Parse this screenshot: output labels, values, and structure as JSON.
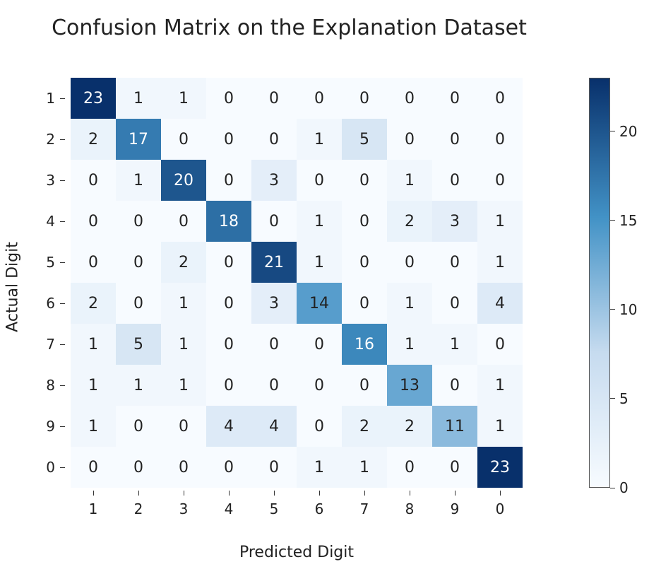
{
  "chart_data": {
    "type": "heatmap",
    "title": "Confusion Matrix on the Explanation Dataset",
    "xlabel": "Predicted Digit",
    "ylabel": "Actual Digit",
    "x_categories": [
      "1",
      "2",
      "3",
      "4",
      "5",
      "6",
      "7",
      "8",
      "9",
      "0"
    ],
    "y_categories": [
      "1",
      "2",
      "3",
      "4",
      "5",
      "6",
      "7",
      "8",
      "9",
      "0"
    ],
    "values": [
      [
        23,
        1,
        1,
        0,
        0,
        0,
        0,
        0,
        0,
        0
      ],
      [
        2,
        17,
        0,
        0,
        0,
        1,
        5,
        0,
        0,
        0
      ],
      [
        0,
        1,
        20,
        0,
        3,
        0,
        0,
        1,
        0,
        0
      ],
      [
        0,
        0,
        0,
        18,
        0,
        1,
        0,
        2,
        3,
        1
      ],
      [
        0,
        0,
        2,
        0,
        21,
        1,
        0,
        0,
        0,
        1
      ],
      [
        2,
        0,
        1,
        0,
        3,
        14,
        0,
        1,
        0,
        4
      ],
      [
        1,
        5,
        1,
        0,
        0,
        0,
        16,
        1,
        1,
        0
      ],
      [
        1,
        1,
        1,
        0,
        0,
        0,
        0,
        13,
        0,
        1
      ],
      [
        1,
        0,
        0,
        4,
        4,
        0,
        2,
        2,
        11,
        1
      ],
      [
        0,
        0,
        0,
        0,
        0,
        1,
        1,
        0,
        0,
        23
      ]
    ],
    "colorbar_ticks": [
      0,
      5,
      10,
      15,
      20
    ],
    "value_range": [
      0,
      23
    ],
    "colormap_stops": [
      {
        "t": 0.0,
        "color": "#f7fbff"
      },
      {
        "t": 0.33,
        "color": "#c6dbef"
      },
      {
        "t": 0.66,
        "color": "#4292c6"
      },
      {
        "t": 1.0,
        "color": "#08306b"
      }
    ]
  }
}
